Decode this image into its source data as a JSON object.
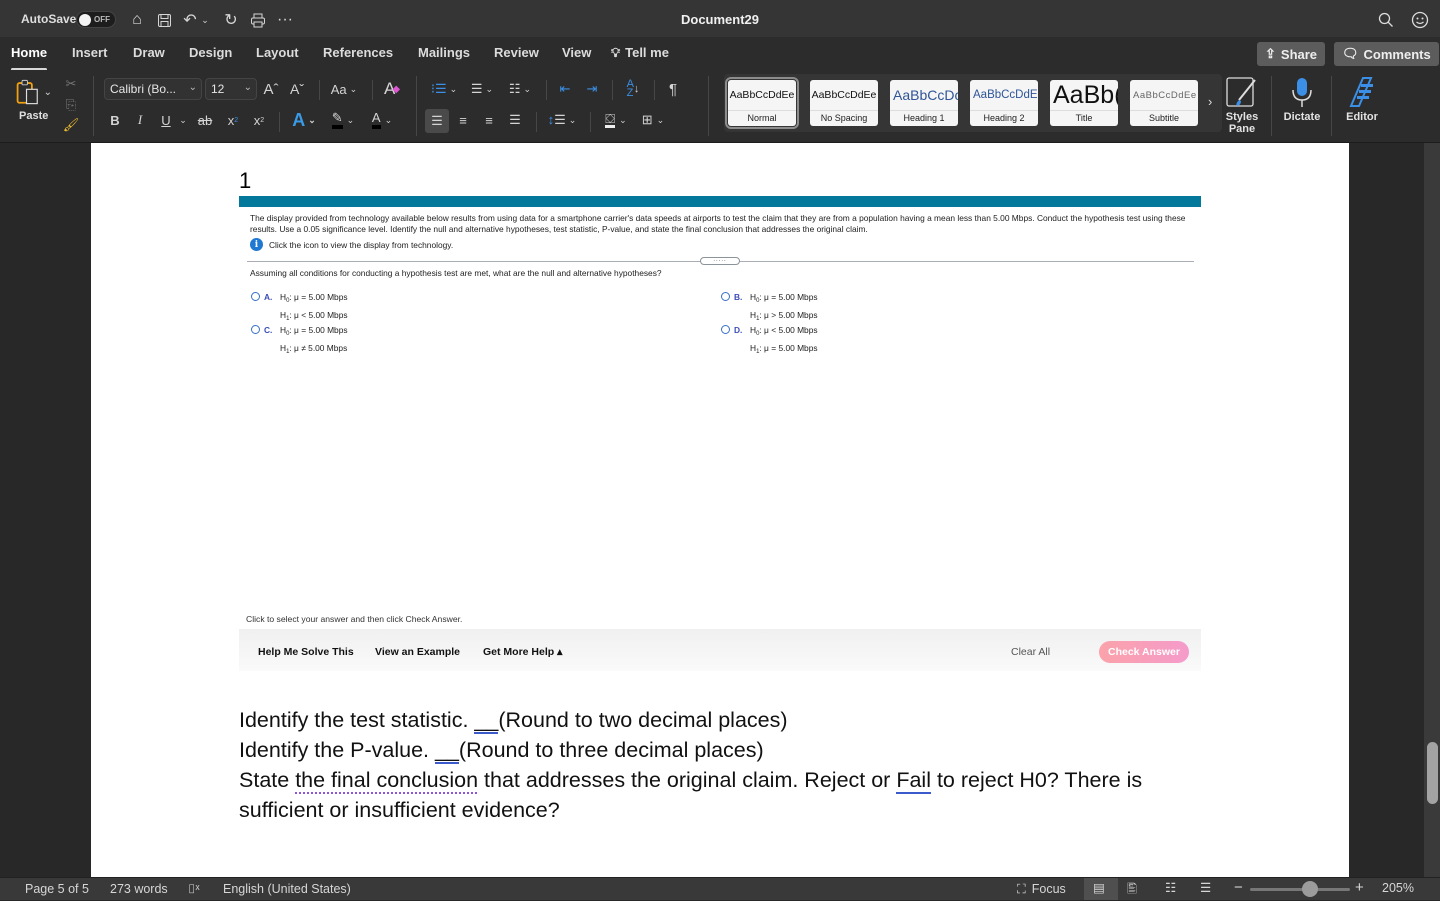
{
  "titlebar": {
    "autosave_label": "AutoSave",
    "autosave_state": "OFF",
    "document_title": "Document29",
    "quick_access": [
      "home-icon",
      "save-icon",
      "undo-icon",
      "undo-dropdown-icon",
      "redo-icon",
      "print-icon",
      "more-icon"
    ]
  },
  "tabs": [
    {
      "label": "Home",
      "active": true
    },
    {
      "label": "Insert"
    },
    {
      "label": "Draw"
    },
    {
      "label": "Design"
    },
    {
      "label": "Layout"
    },
    {
      "label": "References"
    },
    {
      "label": "Mailings"
    },
    {
      "label": "Review"
    },
    {
      "label": "View"
    },
    {
      "label": "Tell me"
    }
  ],
  "top_buttons": {
    "share": "Share",
    "comments": "Comments"
  },
  "ribbon": {
    "paste_label": "Paste",
    "font_name": "Calibri (Bo...",
    "font_size": "12",
    "change_case_label": "Aa",
    "styles": [
      {
        "preview": "AaBbCcDdEe",
        "name": "Normal",
        "selected": true
      },
      {
        "preview": "AaBbCcDdEe",
        "name": "No Spacing"
      },
      {
        "preview": "AaBbCcDc",
        "name": "Heading 1"
      },
      {
        "preview": "AaBbCcDdEe",
        "name": "Heading 2"
      },
      {
        "preview": "AaBb(",
        "name": "Title"
      },
      {
        "preview": "AaBbCcDdEe",
        "name": "Subtitle"
      }
    ],
    "styles_pane_label": "Styles Pane",
    "dictate_label": "Dictate",
    "editor_label": "Editor"
  },
  "document": {
    "question_number": "1",
    "question_text": "The display provided from technology available below results from using data for a smartphone carrier's data speeds at airports to test the claim that they are from a population having a mean less than 5.00 Mbps. Conduct the hypothesis test using these results. Use a 0.05 significance level. Identify the null and alternative hypotheses, test statistic, P-value, and state the final conclusion that addresses the original claim.",
    "info_text": "Click the icon to view the display from technology.",
    "handle_dots": ".....",
    "prompt": "Assuming all conditions for conducting a hypothesis test are met, what are the null and alternative hypotheses?",
    "options": [
      {
        "letter": "A.",
        "h0_rel": "=",
        "h1_rel": "<",
        "value": "5.00 Mbps"
      },
      {
        "letter": "B.",
        "h0_rel": "=",
        "h1_rel": ">",
        "value": "5.00 Mbps"
      },
      {
        "letter": "C.",
        "h0_rel": "=",
        "h1_rel": "≠",
        "value": "5.00 Mbps"
      },
      {
        "letter": "D.",
        "h0_rel": "<",
        "h1_rel": "=",
        "value": "5.00 Mbps"
      }
    ],
    "instruction": "Click to select your answer and then click Check Answer.",
    "help_buttons": {
      "solve": "Help Me Solve This",
      "example": "View an Example",
      "more": "Get More Help ▴"
    },
    "clear_all": "Clear All",
    "check_answer": "Check Answer",
    "line1_a": "Identify the test statistic. ",
    "line1_blank": "__",
    "line1_b": "(Round to two decimal places)",
    "line2_a": "Identify the P-value. ",
    "line2_blank": "__",
    "line2_b": "(Round to three decimal places)",
    "line3_a": "State ",
    "line3_dotted": "the final conclusion",
    "line3_b": " that addresses the original claim. Reject or ",
    "line3_fail": "Fail",
    "line3_c": " to reject H0? There is sufficient or insufficient evidence?"
  },
  "statusbar": {
    "page": "Page 5 of 5",
    "words": "273 words",
    "language": "English (United States)",
    "focus": "Focus",
    "zoom": "205%",
    "zoom_level_percent": 205
  }
}
